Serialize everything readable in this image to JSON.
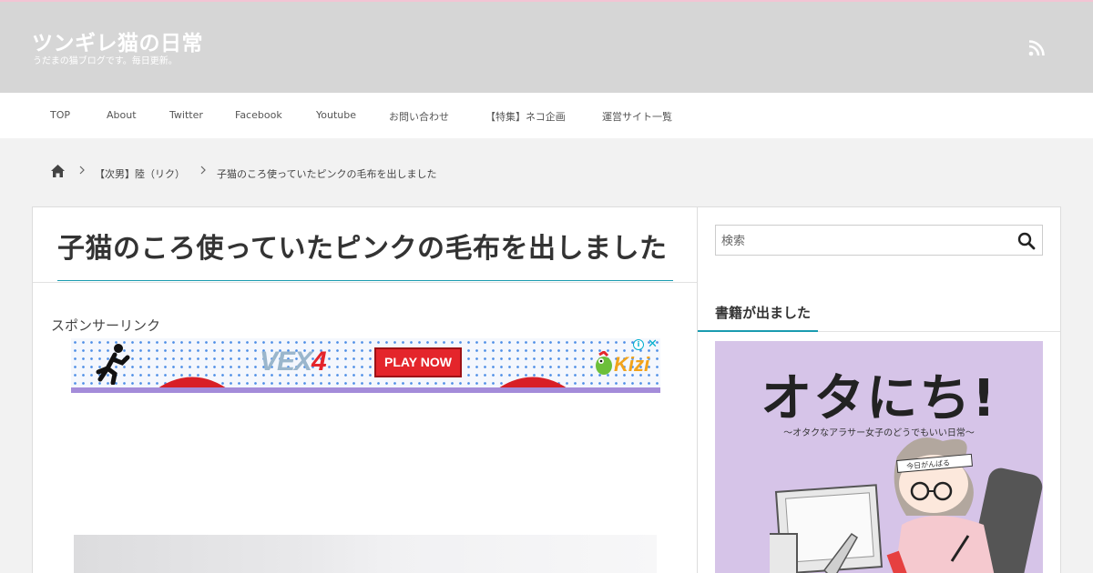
{
  "site": {
    "title": "ツンギレ猫の日常",
    "description": "うだまの猫ブログです。毎日更新。",
    "accent_color": "#1a9bb0",
    "header_bg": "#d6d6d6"
  },
  "nav": {
    "items": [
      {
        "label": "TOP"
      },
      {
        "label": "About"
      },
      {
        "label": "Twitter"
      },
      {
        "label": "Facebook"
      },
      {
        "label": "Youtube"
      },
      {
        "label": "お問い合わせ"
      },
      {
        "label": "【特集】ネコ企画"
      },
      {
        "label": "運営サイト一覧"
      }
    ]
  },
  "breadcrumb": {
    "home_icon": "home-icon",
    "category": "【次男】陸（リク）",
    "current": "子猫のころ使っていたピンクの毛布を出しました"
  },
  "post": {
    "title": "子猫のころ使っていたピンクの毛布を出しました",
    "sponsor_label": "スポンサーリンク"
  },
  "ad": {
    "game_logo_prefix": "VEX",
    "game_logo_number": "4",
    "cta": "PLAY NOW",
    "brand": "Kizi",
    "info_icon": "i",
    "close_icon": "✕"
  },
  "sidebar": {
    "search_placeholder": "検索",
    "widget_title": "書籍が出ました",
    "book": {
      "title": "オタにち!",
      "subtitle": "〜オタクなアラサー女子のどうでもいい日常〜",
      "headband_text": "今日がんばる"
    }
  }
}
